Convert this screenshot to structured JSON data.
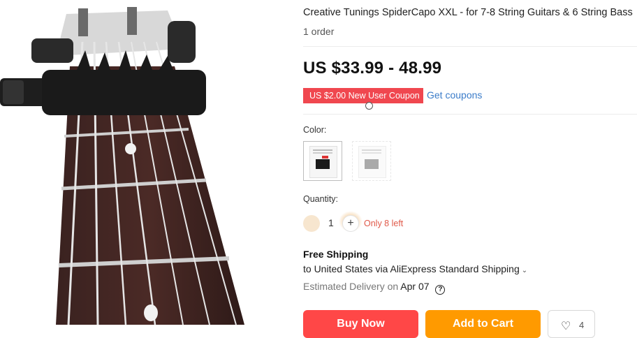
{
  "product": {
    "title": "Creative Tunings SpiderCapo XXL - for 7-8 String Guitars & 6 String Bass",
    "orders": "1 order",
    "price": "US $33.99 - 48.99",
    "image_alt": "guitar neck with capo"
  },
  "coupon": {
    "badge": "US $2.00 New User Coupon",
    "link": "Get coupons"
  },
  "color": {
    "label": "Color:",
    "options": [
      "option-1",
      "option-2"
    ]
  },
  "quantity": {
    "label": "Quantity:",
    "value": "1",
    "plus": "+",
    "stock_note": "Only 8 left"
  },
  "shipping": {
    "title": "Free Shipping",
    "line": "to United States via AliExpress Standard Shipping",
    "delivery_label": "Estimated Delivery on",
    "delivery_date": "Apr 07"
  },
  "actions": {
    "buy_now": "Buy Now",
    "add_to_cart": "Add to Cart",
    "wishlist_count": "4"
  },
  "colors": {
    "price_red": "#f0474f",
    "link_blue": "#3b7cc9",
    "buy_red": "#ff4747",
    "cart_orange": "#ff9a00"
  }
}
